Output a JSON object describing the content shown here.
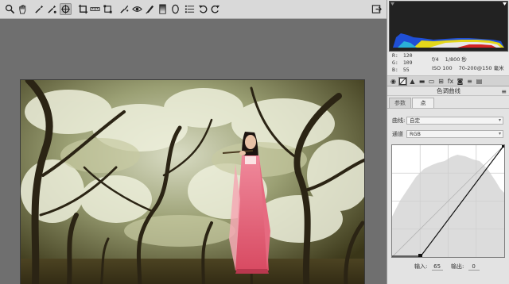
{
  "toolbar": {
    "tools": [
      "zoom-tool",
      "hand-tool",
      "white-balance-tool",
      "color-sampler-tool",
      "targeted-adjustment-tool",
      "crop-tool",
      "straighten-tool",
      "transform-tool",
      "spot-removal-tool",
      "red-eye-tool",
      "adjustment-brush-tool",
      "graduated-filter-tool",
      "radial-filter-tool",
      "preferences-tool",
      "rotate-left-tool",
      "rotate-right-tool"
    ],
    "active_tool": "targeted-adjustment-tool"
  },
  "info": {
    "r_label": "R:",
    "r_value": "120",
    "g_label": "G:",
    "g_value": "109",
    "b_label": "B:",
    "b_value": "55",
    "aperture": "f/4",
    "shutter": "1/800 秒",
    "iso": "ISO 100",
    "lens": "70-200@150 毫米"
  },
  "panel": {
    "section_title": "色调曲线",
    "subtab_parametric": "参数",
    "subtab_point": "点",
    "curve_label": "曲线:",
    "curve_value": "自定",
    "channel_label": "通道",
    "channel_value": "RGB",
    "input_label": "输入:",
    "input_value": "65",
    "output_label": "输出:",
    "output_value": "0"
  },
  "colors": {
    "toolbar_bg": "#d9d9d9",
    "canvas_bg": "#6f6f6f",
    "panel_bg": "#e3e3e3",
    "histogram_bg": "#222222",
    "photo_dress": "#e2657c"
  }
}
